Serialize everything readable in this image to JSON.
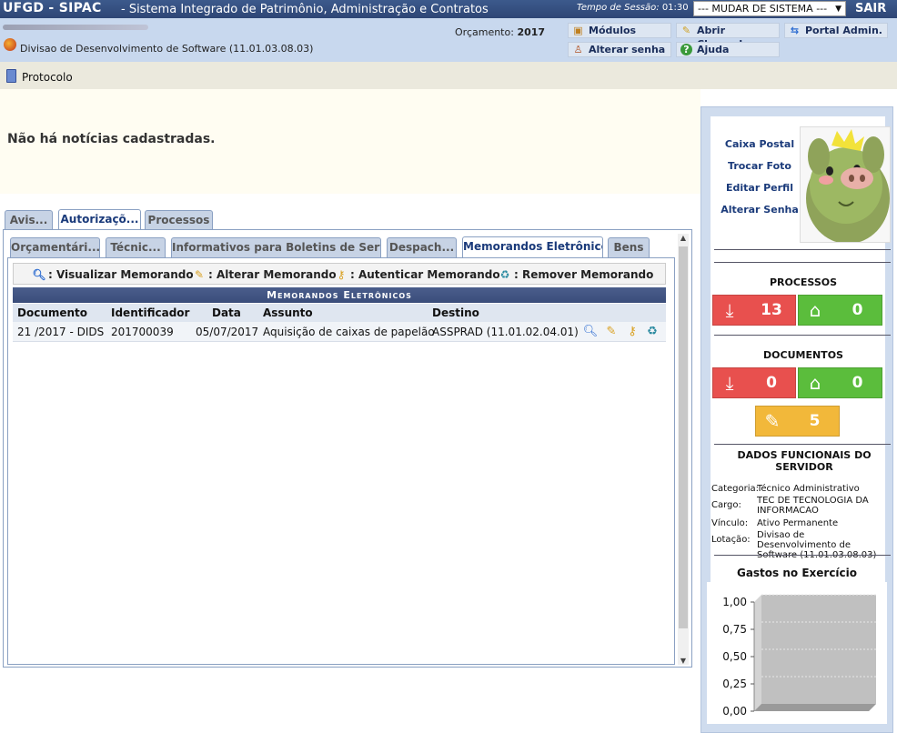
{
  "topbar": {
    "system": "UFGD - SIPAC",
    "system_name": "- Sistema Integrado de Patrimônio, Administração e Contratos",
    "session_label": "Tempo de Sessão:",
    "session_time": "01:30",
    "change_system": "--- MUDAR DE SISTEMA ---",
    "logout": "SAIR"
  },
  "infobar": {
    "unit": "Divisao de Desenvolvimento de Software (11.01.03.08.03)",
    "budget_label": "Orçamento:",
    "budget_year": "2017",
    "buttons": [
      {
        "label": "Módulos",
        "icon": "modules-icon"
      },
      {
        "label": "Abrir Chamado",
        "icon": "broom-icon"
      },
      {
        "label": "Portal Admin.",
        "icon": "portal-icon"
      },
      {
        "label": "Alterar senha",
        "icon": "user-key-icon"
      },
      {
        "label": "Ajuda",
        "icon": "help-icon"
      }
    ]
  },
  "module": {
    "label": "Protocolo"
  },
  "news": {
    "message": "Não há notícias cadastradas."
  },
  "tabs": [
    "Avis...",
    "Autorizaçõ...",
    "Processos"
  ],
  "subtabs": [
    "Orçamentári...",
    "Técnic...",
    "Informativos para Boletins de Serviç...",
    "Despach...",
    "Memorandos Eletrônicos",
    "Bens"
  ],
  "legend": {
    "view": ": Visualizar Memorando",
    "edit": ": Alterar Memorando",
    "auth": ": Autenticar Memorando",
    "remove": ": Remover Memorando"
  },
  "table": {
    "title": "Memorandos Eletrônicos",
    "columns": [
      "Documento",
      "Identificador",
      "Data",
      "Assunto",
      "Destino"
    ],
    "rows": [
      {
        "documento": "21 /2017 - DIDS",
        "identificador": "201700039",
        "data": "05/07/2017",
        "assunto": "Aquisição de caixas de papelão",
        "destino": "ASSPRAD (11.01.02.04.01)"
      }
    ]
  },
  "sidebar": {
    "links": [
      "Caixa Postal",
      "Trocar Foto",
      "Editar Perfil",
      "Alterar Senha"
    ],
    "processos_title": "PROCESSOS",
    "processos": {
      "received": "13",
      "in_unit": "0"
    },
    "documentos_title": "DOCUMENTOS",
    "documentos": {
      "received": "0",
      "in_unit": "0",
      "signed": "5"
    },
    "dados_title": "DADOS FUNCIONAIS DO SERVIDOR",
    "dados": [
      {
        "label": "Categoria:",
        "value": "Técnico Administrativo"
      },
      {
        "label": "Cargo:",
        "value": "TEC DE TECNOLOGIA DA INFORMACAO"
      },
      {
        "label": "Vínculo:",
        "value": "Ativo Permanente"
      },
      {
        "label": "Lotação:",
        "value": "Divisao de Desenvolvimento de Software (11.01.03.08.03)"
      }
    ],
    "chart_title": "Gastos no Exercício"
  },
  "chart_data": {
    "type": "bar",
    "title": "Gastos no Exercício",
    "categories": [],
    "values": [],
    "ylim": [
      0,
      1
    ],
    "yticks": [
      "1,00",
      "0,75",
      "0,50",
      "0,25",
      "0,00"
    ],
    "grid": true
  },
  "colors": {
    "topbar": "#2e4675",
    "infobar": "#c8d8ee",
    "red": "#e8504e",
    "green": "#5bbd3c",
    "orange": "#f2b83a"
  }
}
